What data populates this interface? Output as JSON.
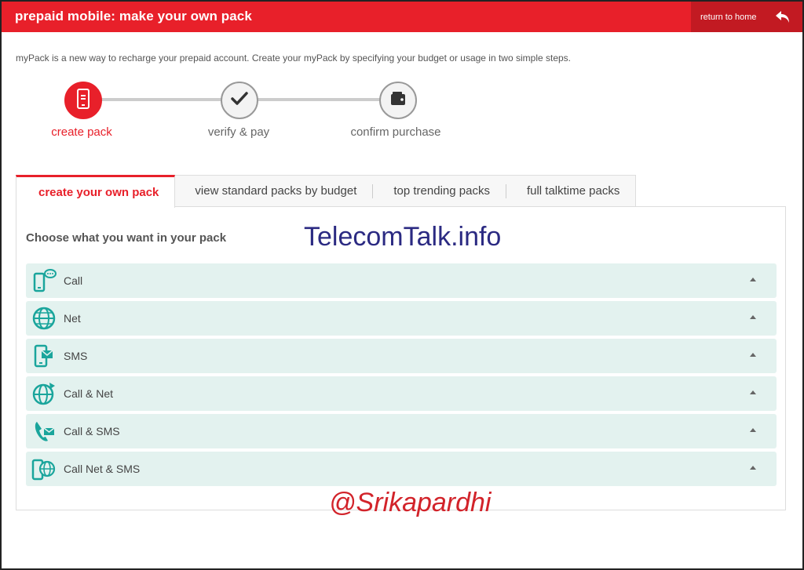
{
  "header": {
    "title": "prepaid mobile: make your own pack",
    "home_label": "return to home",
    "colors": {
      "brand": "#e8202a",
      "brand_dark": "#c21a22"
    }
  },
  "intro_text": "myPack is a new way to recharge your prepaid account. Create your myPack by specifying your budget or usage in two simple steps.",
  "steps": [
    {
      "label": "create pack",
      "icon": "phone-icon",
      "state": "active"
    },
    {
      "label": "verify & pay",
      "icon": "checkmark-icon",
      "state": "pending"
    },
    {
      "label": "confirm purchase",
      "icon": "wallet-icon",
      "state": "pending"
    }
  ],
  "tabs": [
    {
      "label": "create your own pack",
      "active": true
    },
    {
      "label": "view standard packs by budget",
      "active": false
    },
    {
      "label": "top trending packs",
      "active": false
    },
    {
      "label": "full talktime packs",
      "active": false
    }
  ],
  "panel": {
    "heading": "Choose what you want in your pack",
    "watermark": "TelecomTalk.info",
    "items": [
      {
        "label": "Call",
        "icon": "phone-chat-icon"
      },
      {
        "label": "Net",
        "icon": "globe-icon"
      },
      {
        "label": "SMS",
        "icon": "phone-message-icon"
      },
      {
        "label": "Call & Net",
        "icon": "globe-arrow-icon"
      },
      {
        "label": "Call & SMS",
        "icon": "handset-message-icon"
      },
      {
        "label": "Call Net & SMS",
        "icon": "phone-globe-icon"
      }
    ],
    "item_color": "#e3f2ef",
    "icon_color": "#1aa59c"
  },
  "credit": "@Srikapardhi"
}
